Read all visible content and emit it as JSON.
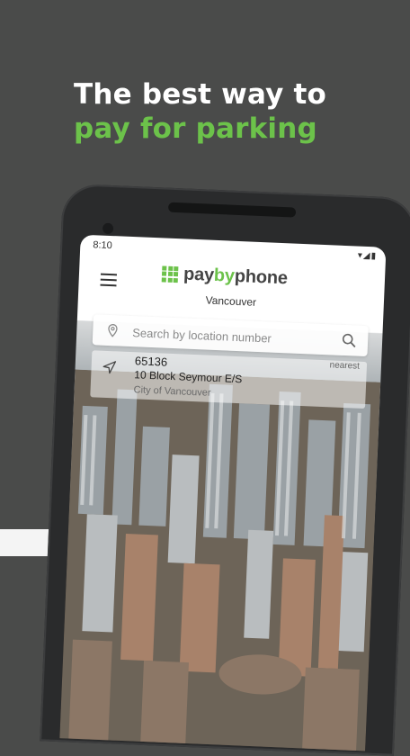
{
  "headline": {
    "line1": "The best way to",
    "line2": "pay for parking"
  },
  "status": {
    "time": "8:10",
    "icons": "▾◢▮"
  },
  "app": {
    "logo_pay": "pay",
    "logo_by": "by",
    "logo_phone": "phone",
    "city": "Vancouver",
    "brand_color": "#6cc24a"
  },
  "search": {
    "placeholder": "Search by location number"
  },
  "result": {
    "number": "65136",
    "street": "10 Block Seymour E/S",
    "place": "City of Vancouver",
    "tag": "nearest"
  },
  "icons": [
    "menu-icon",
    "location-pin-icon",
    "search-icon",
    "navigation-arrow-icon",
    "wifi-icon",
    "signal-icon",
    "battery-icon"
  ]
}
